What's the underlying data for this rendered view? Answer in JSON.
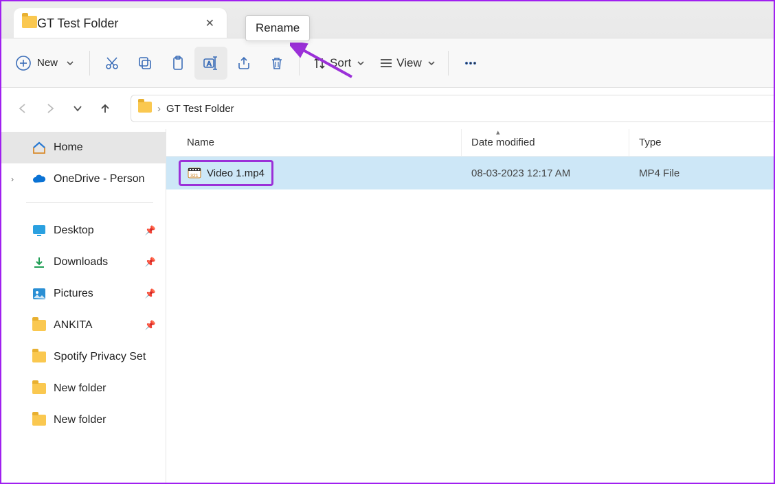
{
  "tab": {
    "title": "GT Test Folder"
  },
  "tooltip": "Rename",
  "toolbar": {
    "new_label": "New",
    "sort_label": "Sort",
    "view_label": "View"
  },
  "breadcrumb": {
    "current": "GT Test Folder"
  },
  "sidebar": {
    "home": "Home",
    "onedrive": "OneDrive - Person",
    "items": [
      {
        "label": "Desktop",
        "pinned": true
      },
      {
        "label": "Downloads",
        "pinned": true
      },
      {
        "label": "Pictures",
        "pinned": true
      },
      {
        "label": "ANKITA",
        "pinned": true
      },
      {
        "label": "Spotify Privacy Set",
        "pinned": false
      },
      {
        "label": "New folder",
        "pinned": false
      },
      {
        "label": "New folder",
        "pinned": false
      }
    ]
  },
  "columns": {
    "name": "Name",
    "date": "Date modified",
    "type": "Type"
  },
  "files": [
    {
      "name": "Video 1.mp4",
      "date": "08-03-2023 12:17 AM",
      "type": "MP4 File"
    }
  ]
}
